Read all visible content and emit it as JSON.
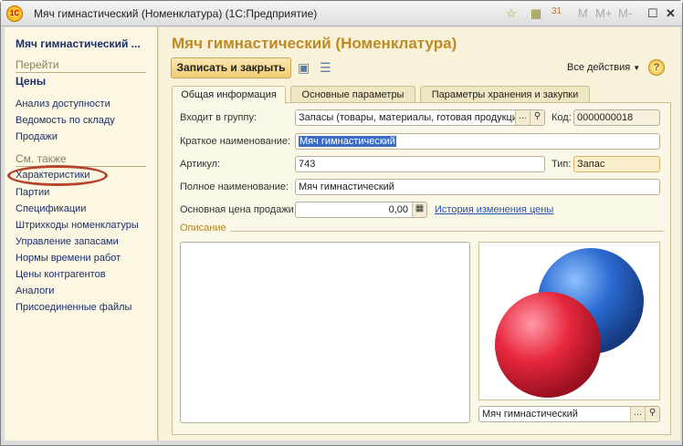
{
  "window": {
    "title": "Мяч гимнастический (Номенклатура)  (1С:Предприятие)",
    "logo": "1С",
    "toolbar_icons": [
      "favorite-icon",
      "calculator-icon",
      "calendar-icon",
      "M",
      "M+",
      "M-",
      "maximize-icon",
      "close-icon"
    ],
    "m_labels": [
      "M",
      "M+",
      "M-"
    ]
  },
  "sidebar": {
    "title": "Мяч гимнастический ...",
    "goto_header": "Перейти",
    "goto_items": [
      "Цены",
      "Анализ доступности",
      "Ведомость по складу",
      "Продажи"
    ],
    "see_also_header": "См. также",
    "see_also_items": [
      "Характеристики",
      "Партии",
      "Спецификации",
      "Штрихкоды номенклатуры",
      "Управление запасами",
      "Нормы времени работ",
      "Цены контрагентов",
      "Аналоги",
      "Присоединенные файлы"
    ]
  },
  "main": {
    "title": "Мяч гимнастический (Номенклатура)",
    "save_close": "Записать и закрыть",
    "all_actions": "Все действия",
    "help": "?",
    "tabs": [
      "Общая информация",
      "Основные параметры",
      "Параметры хранения и закупки"
    ],
    "fields": {
      "group_label": "Входит в группу:",
      "group_value": "Запасы (товары, материалы, готовая продукция)",
      "code_label": "Код:",
      "code_value": "0000000018",
      "short_label": "Краткое наименование:",
      "short_value": "Мяч гимнастический",
      "article_label": "Артикул:",
      "article_value": "743",
      "type_label": "Тип:",
      "type_value": "Запас",
      "full_label": "Полное наименование:",
      "full_value": "Мяч гимнастический",
      "price_label": "Основная цена продажи:",
      "price_value": "0,00",
      "price_history": "История изменения цены",
      "description_label": "Описание",
      "image_name": "Мяч гимнастический"
    },
    "colors": {
      "accent": "#c08a22",
      "link": "#1f54b8",
      "highlight": "#b5432e"
    }
  }
}
